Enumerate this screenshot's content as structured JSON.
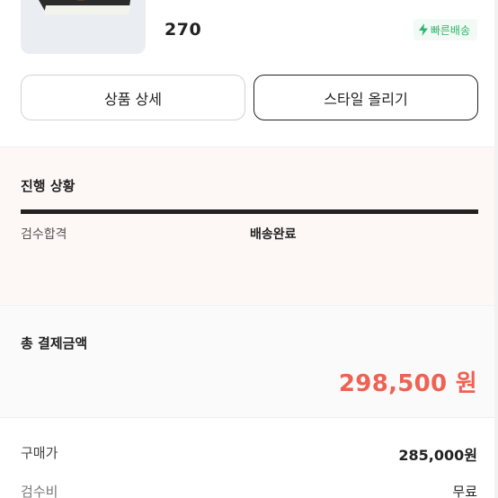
{
  "product": {
    "size": "270",
    "fast_delivery_label": "빠른배송"
  },
  "actions": {
    "detail_label": "상품 상세",
    "style_label": "스타일 올리기"
  },
  "progress": {
    "title": "진행 상황",
    "steps": [
      "검수합격",
      "배송완료"
    ]
  },
  "total": {
    "label": "총 결제금액",
    "amount": "298,500 원"
  },
  "breakdown": [
    {
      "label": "구매가",
      "value": "285,000원"
    },
    {
      "label": "검수비",
      "value": "무료"
    }
  ],
  "colors": {
    "accent_red": "#ef6253",
    "fast_green": "#31b46e"
  }
}
